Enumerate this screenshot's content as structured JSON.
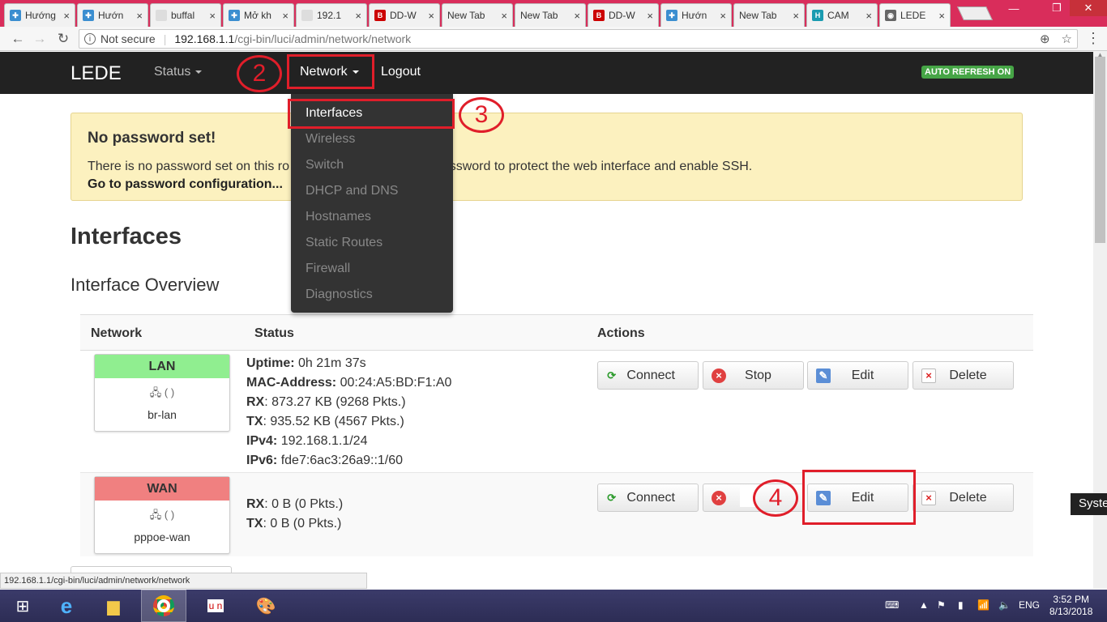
{
  "browser": {
    "tabs": [
      {
        "title": "Hướng",
        "favicon": "globe-icon",
        "active": false
      },
      {
        "title": "Hướn",
        "favicon": "globe-icon",
        "active": false
      },
      {
        "title": "buffal",
        "favicon": "page-icon",
        "active": false
      },
      {
        "title": "Mở kh",
        "favicon": "globe-icon",
        "active": false
      },
      {
        "title": "192.1",
        "favicon": "page-icon",
        "active": false
      },
      {
        "title": "DD-W",
        "favicon": "ddwrt-icon",
        "active": false
      },
      {
        "title": "New Tab",
        "favicon": "",
        "active": false
      },
      {
        "title": "New Tab",
        "favicon": "",
        "active": false
      },
      {
        "title": "DD-W",
        "favicon": "ddwrt-icon",
        "active": false
      },
      {
        "title": "Hướn",
        "favicon": "globe-icon",
        "active": false
      },
      {
        "title": "New Tab",
        "favicon": "",
        "active": false
      },
      {
        "title": "CAM",
        "favicon": "h-icon",
        "active": false
      },
      {
        "title": "LEDE",
        "favicon": "lede-icon",
        "active": true
      }
    ],
    "tab_close": "×",
    "address": {
      "security": "Not secure",
      "host": "192.168.1.1",
      "path": "/cgi-bin/luci/admin/network/network"
    },
    "status_url": "192.168.1.1/cgi-bin/luci/admin/network/network"
  },
  "nav": {
    "brand": "LEDE",
    "status": "Status",
    "network": "Network",
    "logout": "Logout",
    "autorefresh": "AUTO REFRESH ON"
  },
  "dropdown": {
    "items": [
      "Interfaces",
      "Wireless",
      "Switch",
      "DHCP and DNS",
      "Hostnames",
      "Static Routes",
      "Firewall",
      "Diagnostics"
    ]
  },
  "alert": {
    "title": "No password set!",
    "text_left": "There is no password set on this ro",
    "text_right": "t password to protect the web interface and enable SSH.",
    "link": "Go to password configuration..."
  },
  "page": {
    "title": "Interfaces",
    "subtitle": "Interface Overview"
  },
  "table": {
    "headers": {
      "network": "Network",
      "status": "Status",
      "actions": "Actions"
    },
    "lan": {
      "name": "LAN",
      "header_color": "#90ee90",
      "icons": "(  )",
      "device": "br-lan",
      "status": [
        {
          "k": "Uptime:",
          "v": " 0h 21m 37s"
        },
        {
          "k": "MAC-Address:",
          "v": " 00:24:A5:BD:F1:A0"
        },
        {
          "k": "RX",
          "v": ": 873.27 KB (9268 Pkts.)"
        },
        {
          "k": "TX",
          "v": ": 935.52 KB (4567 Pkts.)"
        },
        {
          "k": "IPv4:",
          "v": " 192.168.1.1/24"
        },
        {
          "k": "IPv6:",
          "v": " fde7:6ac3:26a9::1/60"
        }
      ]
    },
    "wan": {
      "name": "WAN",
      "header_color": "#f08080",
      "icons": "(  )",
      "device": "pppoe-wan",
      "status": [
        {
          "k": "RX",
          "v": ": 0 B (0 Pkts.)"
        },
        {
          "k": "TX",
          "v": ": 0 B (0 Pkts.)"
        }
      ]
    },
    "buttons": {
      "connect": "Connect",
      "stop": "Stop",
      "edit": "Edit",
      "delete": "Delete"
    }
  },
  "annotations": {
    "n2": "2",
    "n3": "3",
    "n4": "4"
  },
  "overlay": {
    "system_tip": "Syste"
  },
  "taskbar": {
    "lang": "ENG",
    "time": "3:52 PM",
    "date": "8/13/2018"
  }
}
